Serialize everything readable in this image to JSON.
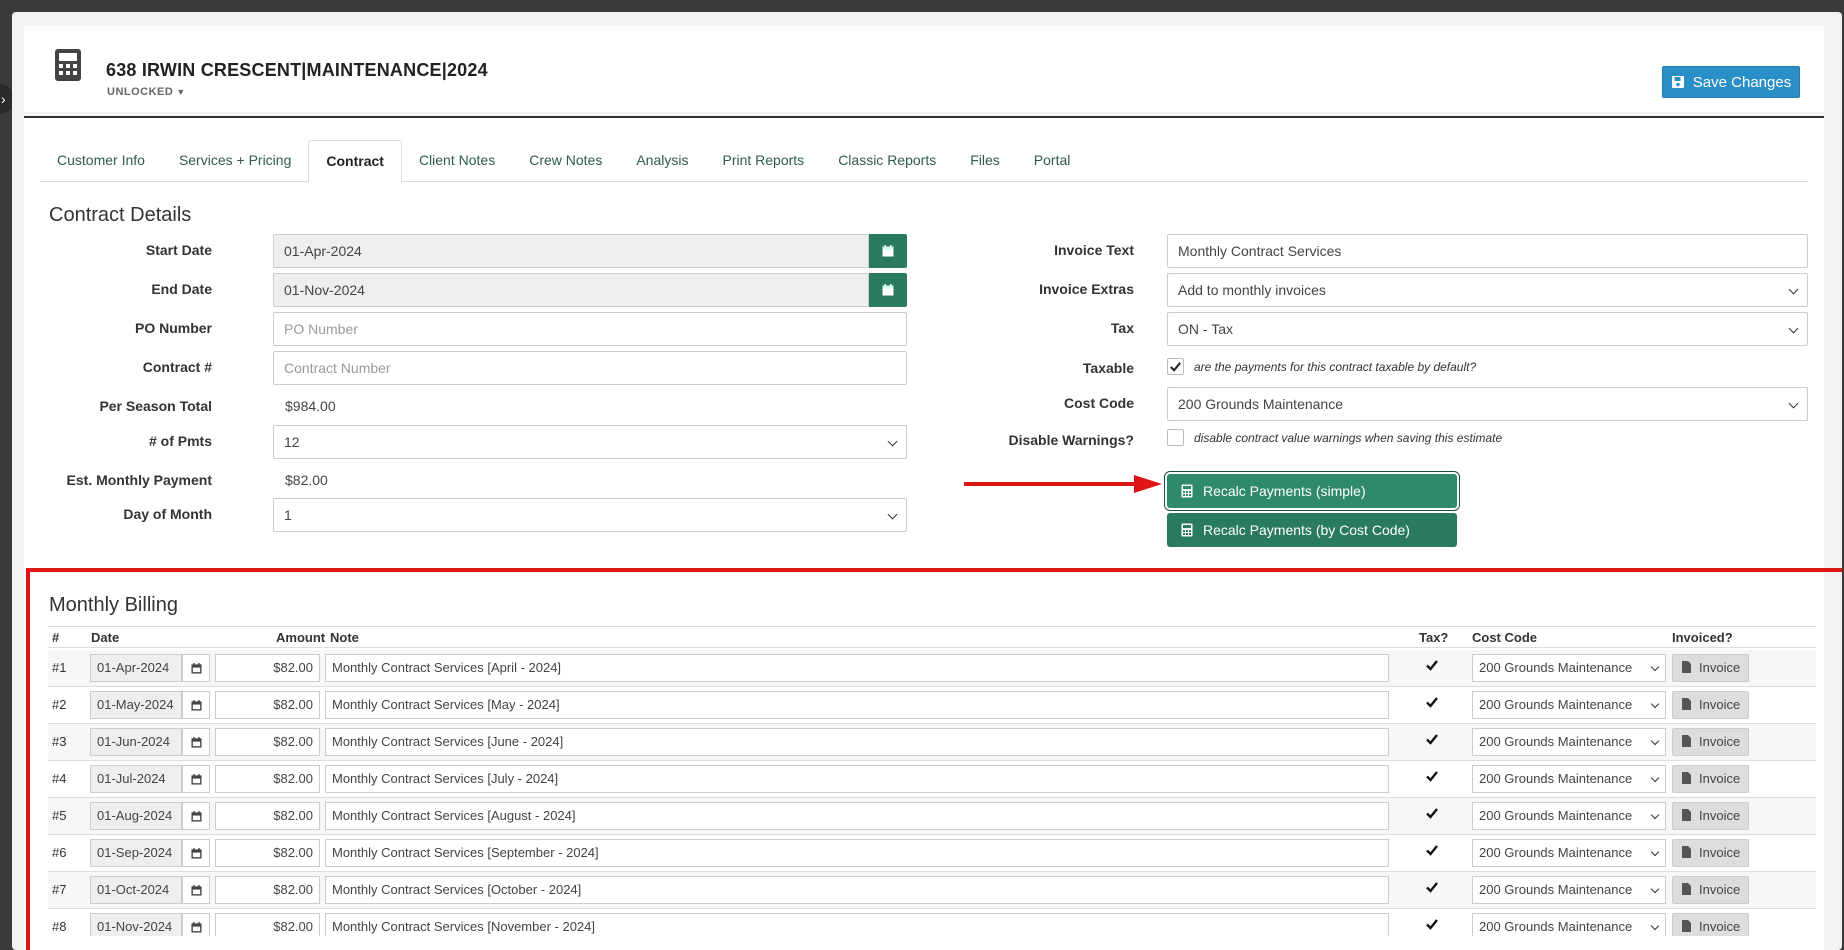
{
  "header": {
    "title": "638 IRWIN CRESCENT|MAINTENANCE|2024",
    "lock_status": "UNLOCKED",
    "save_label": "Save Changes"
  },
  "tabs": [
    {
      "label": "Customer Info",
      "active": false
    },
    {
      "label": "Services + Pricing",
      "active": false
    },
    {
      "label": "Contract",
      "active": true
    },
    {
      "label": "Client Notes",
      "active": false
    },
    {
      "label": "Crew Notes",
      "active": false
    },
    {
      "label": "Analysis",
      "active": false
    },
    {
      "label": "Print Reports",
      "active": false
    },
    {
      "label": "Classic Reports",
      "active": false
    },
    {
      "label": "Files",
      "active": false
    },
    {
      "label": "Portal",
      "active": false
    }
  ],
  "contract": {
    "title": "Contract Details",
    "start_date_label": "Start Date",
    "start_date": "01-Apr-2024",
    "end_date_label": "End Date",
    "end_date": "01-Nov-2024",
    "po_label": "PO Number",
    "po_placeholder": "PO Number",
    "contract_no_label": "Contract #",
    "contract_no_placeholder": "Contract Number",
    "season_total_label": "Per Season Total",
    "season_total": "$984.00",
    "num_pmts_label": "# of Pmts",
    "num_pmts": "12",
    "monthly_label": "Est. Monthly Payment",
    "monthly": "$82.00",
    "day_label": "Day of Month",
    "day": "1",
    "invoice_text_label": "Invoice Text",
    "invoice_text": "Monthly Contract Services",
    "invoice_extras_label": "Invoice Extras",
    "invoice_extras": "Add to monthly invoices",
    "tax_label": "Tax",
    "tax": "ON - Tax",
    "taxable_label": "Taxable",
    "taxable_checked": true,
    "taxable_desc": "are the payments for this contract taxable by default?",
    "cost_code_label": "Cost Code",
    "cost_code": "200 Grounds Maintenance",
    "disable_warnings_label": "Disable Warnings?",
    "disable_warnings_checked": false,
    "disable_warnings_desc": "disable contract value warnings when saving this estimate",
    "recalc_simple": "Recalc Payments (simple)",
    "recalc_cost_code": "Recalc Payments (by Cost Code)"
  },
  "billing": {
    "title": "Monthly Billing",
    "columns": {
      "num": "#",
      "date": "Date",
      "amount": "Amount",
      "note": "Note",
      "tax": "Tax?",
      "cost_code": "Cost Code",
      "invoiced": "Invoiced?"
    },
    "rows": [
      {
        "num": "#1",
        "date": "01-Apr-2024",
        "amount": "$82.00",
        "note": "Monthly Contract Services [April - 2024]",
        "tax": true,
        "cost_code": "200 Grounds Maintenance",
        "invoice_label": "Invoice"
      },
      {
        "num": "#2",
        "date": "01-May-2024",
        "amount": "$82.00",
        "note": "Monthly Contract Services [May - 2024]",
        "tax": true,
        "cost_code": "200 Grounds Maintenance",
        "invoice_label": "Invoice"
      },
      {
        "num": "#3",
        "date": "01-Jun-2024",
        "amount": "$82.00",
        "note": "Monthly Contract Services [June - 2024]",
        "tax": true,
        "cost_code": "200 Grounds Maintenance",
        "invoice_label": "Invoice"
      },
      {
        "num": "#4",
        "date": "01-Jul-2024",
        "amount": "$82.00",
        "note": "Monthly Contract Services [July - 2024]",
        "tax": true,
        "cost_code": "200 Grounds Maintenance",
        "invoice_label": "Invoice"
      },
      {
        "num": "#5",
        "date": "01-Aug-2024",
        "amount": "$82.00",
        "note": "Monthly Contract Services [August - 2024]",
        "tax": true,
        "cost_code": "200 Grounds Maintenance",
        "invoice_label": "Invoice"
      },
      {
        "num": "#6",
        "date": "01-Sep-2024",
        "amount": "$82.00",
        "note": "Monthly Contract Services [September - 2024]",
        "tax": true,
        "cost_code": "200 Grounds Maintenance",
        "invoice_label": "Invoice"
      },
      {
        "num": "#7",
        "date": "01-Oct-2024",
        "amount": "$82.00",
        "note": "Monthly Contract Services [October - 2024]",
        "tax": true,
        "cost_code": "200 Grounds Maintenance",
        "invoice_label": "Invoice"
      },
      {
        "num": "#8",
        "date": "01-Nov-2024",
        "amount": "$82.00",
        "note": "Monthly Contract Services [November - 2024]",
        "tax": true,
        "cost_code": "200 Grounds Maintenance",
        "invoice_label": "Invoice"
      }
    ]
  },
  "colors": {
    "accent_green": "#2a7a5f",
    "save_blue": "#2a8fc7",
    "highlight_red": "#e01515"
  }
}
